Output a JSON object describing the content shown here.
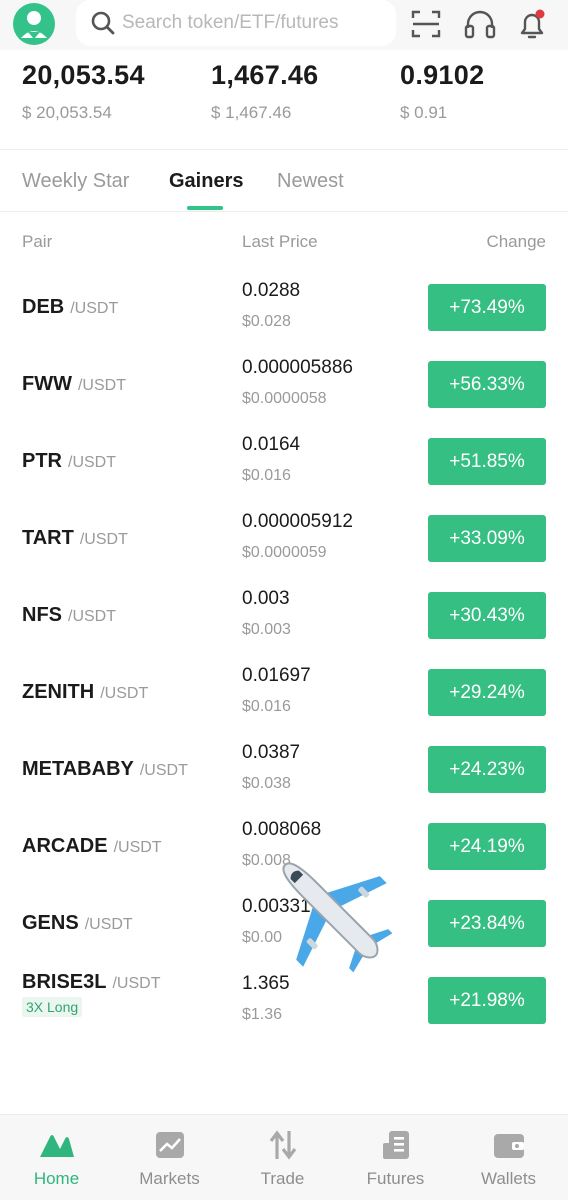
{
  "header": {
    "search_placeholder": "Search token/ETF/futures",
    "icons": [
      "avatar-icon",
      "search-icon",
      "scan-icon",
      "headset-icon",
      "notification-bell-icon"
    ],
    "has_notification_dot": true
  },
  "stats": [
    {
      "value": "20,053.54",
      "usd": "$ 20,053.54"
    },
    {
      "value": "1,467.46",
      "usd": "$ 1,467.46"
    },
    {
      "value": "0.9102",
      "usd": "$ 0.91"
    }
  ],
  "tabs": [
    {
      "label": "Weekly Star",
      "active": false
    },
    {
      "label": "Gainers",
      "active": true
    },
    {
      "label": "Newest",
      "active": false
    }
  ],
  "table": {
    "headers": {
      "pair": "Pair",
      "last_price": "Last Price",
      "change": "Change"
    },
    "rows": [
      {
        "base": "DEB",
        "quote": "/USDT",
        "price": "0.0288",
        "price_usd": "$0.028",
        "change": "+73.49%"
      },
      {
        "base": "FWW",
        "quote": "/USDT",
        "price": "0.000005886",
        "price_usd": "$0.0000058",
        "change": "+56.33%"
      },
      {
        "base": "PTR",
        "quote": "/USDT",
        "price": "0.0164",
        "price_usd": "$0.016",
        "change": "+51.85%"
      },
      {
        "base": "TART",
        "quote": "/USDT",
        "price": "0.000005912",
        "price_usd": "$0.0000059",
        "change": "+33.09%"
      },
      {
        "base": "NFS",
        "quote": "/USDT",
        "price": "0.003",
        "price_usd": "$0.003",
        "change": "+30.43%"
      },
      {
        "base": "ZENITH",
        "quote": "/USDT",
        "price": "0.01697",
        "price_usd": "$0.016",
        "change": "+29.24%"
      },
      {
        "base": "METABABY",
        "quote": "/USDT",
        "price": "0.0387",
        "price_usd": "$0.038",
        "change": "+24.23%"
      },
      {
        "base": "ARCADE",
        "quote": "/USDT",
        "price": "0.008068",
        "price_usd": "$0.008",
        "change": "+24.19%"
      },
      {
        "base": "GENS",
        "quote": "/USDT",
        "price": "0.003319",
        "price_usd": "$0.00",
        "change": "+23.84%"
      },
      {
        "base": "BRISE3L",
        "quote": "/USDT",
        "tag": "3X Long",
        "price": "1.365",
        "price_usd": "$1.36",
        "change": "+21.98%"
      }
    ]
  },
  "overlay": {
    "icon": "airplane-icon"
  },
  "bottom_nav": [
    {
      "label": "Home",
      "icon": "home-icon",
      "active": true
    },
    {
      "label": "Markets",
      "icon": "markets-chart-icon",
      "active": false
    },
    {
      "label": "Trade",
      "icon": "trade-arrows-icon",
      "active": false
    },
    {
      "label": "Futures",
      "icon": "futures-icon",
      "active": false
    },
    {
      "label": "Wallets",
      "icon": "wallet-icon",
      "active": false
    }
  ],
  "colors": {
    "accent": "#32c28a",
    "change_bg": "#36bf83",
    "text_primary": "#1b1b1b",
    "text_muted": "#9a9a9a",
    "header_bg": "#f7f7f7"
  }
}
